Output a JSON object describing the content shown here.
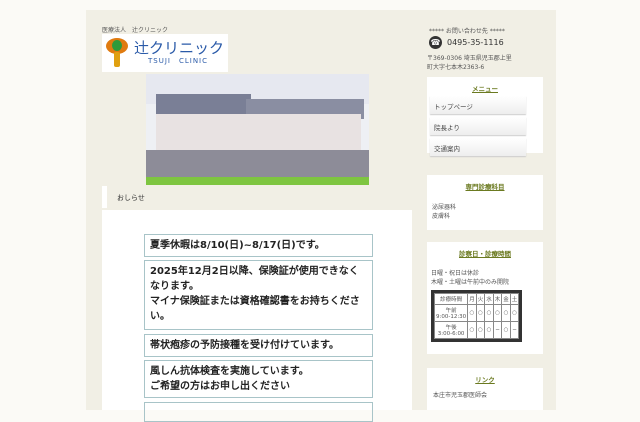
{
  "header": {
    "corp": "医療法人　辻クリニック",
    "logo_jp": "辻クリニック",
    "logo_en": "TSUJI　CLINIC"
  },
  "notice": {
    "title": "おしらせ",
    "items": [
      {
        "lines": [
          "夏季休暇は8/10(日)~8/17(日)です。"
        ]
      },
      {
        "lines": [
          "2025年12月2日以降、保険証が使用できなくなります。",
          "マイナ保険証または資格確認書をお持ちください。"
        ]
      },
      {
        "lines": [
          "帯状疱疹の予防接種を受け付けています。"
        ]
      },
      {
        "lines": [
          "風しん抗体検査を実施しています。",
          "ご希望の方はお申し出ください"
        ]
      }
    ]
  },
  "sidebar": {
    "contact_label": "***** お問い合わせ先 *****",
    "phone": "0495-35-1116",
    "address": "〒369-0306 埼玉県児玉郡上里町大字七本木2363-6",
    "menu": {
      "title": "メニュー",
      "items": [
        "トップページ",
        "院長より",
        "交通案内"
      ]
    },
    "departments": {
      "title": "専門診療科目",
      "items": [
        "泌尿器科",
        "皮膚科"
      ]
    },
    "hours": {
      "title": "診察日・診療時間",
      "notes": [
        "日曜・祝日は休診",
        "木曜・土曜は午前中のみ開院"
      ],
      "header": [
        "診療時間",
        "月",
        "火",
        "水",
        "木",
        "金",
        "土"
      ],
      "rows": [
        {
          "label": "午前",
          "time": "9:00-12:30",
          "marks": [
            "○",
            "○",
            "○",
            "○",
            "○",
            "○"
          ]
        },
        {
          "label": "午後",
          "time": "3:00-6:00",
          "marks": [
            "○",
            "○",
            "○",
            "−",
            "○",
            "−"
          ]
        }
      ]
    },
    "links": {
      "title": "リンク",
      "items": [
        "本庄市児玉郡医師会"
      ]
    }
  }
}
